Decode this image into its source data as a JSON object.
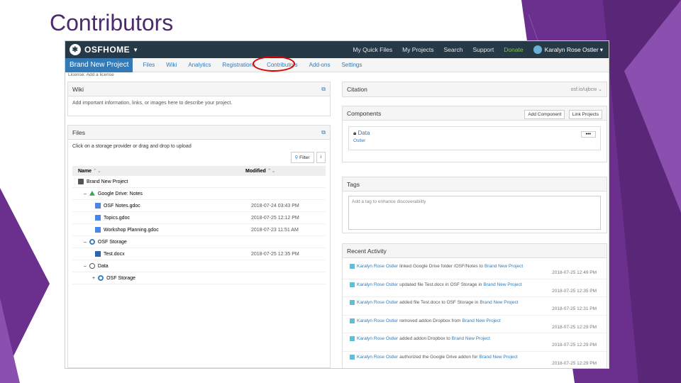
{
  "slide": {
    "title": "Contributors"
  },
  "colors": {
    "accent": "#4b2a6d",
    "decor_purple": "#6b2f8e",
    "osf_nav": "#263947",
    "link": "#337ab7",
    "highlight": "#d90000"
  },
  "topnav": {
    "brand": "OSFHOME",
    "links": [
      "My Quick Files",
      "My Projects",
      "Search",
      "Support",
      "Donate"
    ],
    "user": "Karalyn Rose Ostler"
  },
  "projnav": {
    "title": "Brand New Project",
    "tabs": [
      "Files",
      "Wiki",
      "Analytics",
      "Registrations",
      "Contributors",
      "Add-ons",
      "Settings"
    ],
    "license": "License: Add a license"
  },
  "wiki": {
    "title": "Wiki",
    "body": "Add important information, links, or images here to describe your project."
  },
  "files": {
    "title": "Files",
    "hint": "Click on a storage provider or drag and drop to upload",
    "filter": "Filter",
    "info": "i",
    "col_name": "Name",
    "col_modified": "Modified",
    "rows": [
      {
        "toggle": "",
        "name": "Brand New Project",
        "modified": "",
        "icon": "box",
        "indent": 0
      },
      {
        "toggle": "–",
        "name": "Google Drive: Notes",
        "modified": "",
        "icon": "gd",
        "indent": 1
      },
      {
        "toggle": "",
        "name": "OSF Notes.gdoc",
        "modified": "2018-07-24 03:43 PM",
        "icon": "doc",
        "indent": 2
      },
      {
        "toggle": "",
        "name": "Topics.gdoc",
        "modified": "2018-07-25 12:12 PM",
        "icon": "doc",
        "indent": 2
      },
      {
        "toggle": "",
        "name": "Workshop Planning.gdoc",
        "modified": "2018-07-23 11:51 AM",
        "icon": "doc",
        "indent": 2
      },
      {
        "toggle": "–",
        "name": "OSF Storage",
        "modified": "",
        "icon": "gear",
        "indent": 1
      },
      {
        "toggle": "",
        "name": "Test.docx",
        "modified": "2018-07-25 12:35 PM",
        "icon": "docx",
        "indent": 2
      },
      {
        "toggle": "–",
        "name": "Data",
        "modified": "",
        "icon": "circ",
        "indent": 1
      },
      {
        "toggle": "+",
        "name": "OSF Storage",
        "modified": "",
        "icon": "gear",
        "indent": 2
      }
    ]
  },
  "citation": {
    "title": "Citation",
    "value": "osf.io/ujbcw"
  },
  "components": {
    "title": "Components",
    "add_button": "Add Component",
    "link_button": "Link Projects",
    "item_title": "Data",
    "item_owner": "Ostler",
    "more": "•••"
  },
  "tags": {
    "title": "Tags",
    "placeholder": "Add a tag to enhance discoverability"
  },
  "activity": {
    "title": "Recent Activity",
    "items": [
      {
        "user": "Karalyn Rose Ostler",
        "action": "linked Google Drive folder /OSF/Notes to",
        "target": "Brand New Project",
        "time": "2018-07-25 12:49 PM"
      },
      {
        "user": "Karalyn Rose Ostler",
        "action": "updated file Test.docx in OSF Storage in",
        "target": "Brand New Project",
        "time": "2018-07-25 12:35 PM"
      },
      {
        "user": "Karalyn Rose Ostler",
        "action": "added file Test.docx to OSF Storage in",
        "target": "Brand New Project",
        "time": "2018-07-25 12:31 PM"
      },
      {
        "user": "Karalyn Rose Ostler",
        "action": "removed addon Dropbox from",
        "target": "Brand New Project",
        "time": "2018-07-25 12:29 PM"
      },
      {
        "user": "Karalyn Rose Ostler",
        "action": "added addon Dropbox to",
        "target": "Brand New Project",
        "time": "2018-07-25 12:29 PM"
      },
      {
        "user": "Karalyn Rose Ostler",
        "action": "authorized the Google Drive addon for",
        "target": "Brand New Project",
        "time": "2018-07-25 12:29 PM"
      }
    ]
  }
}
